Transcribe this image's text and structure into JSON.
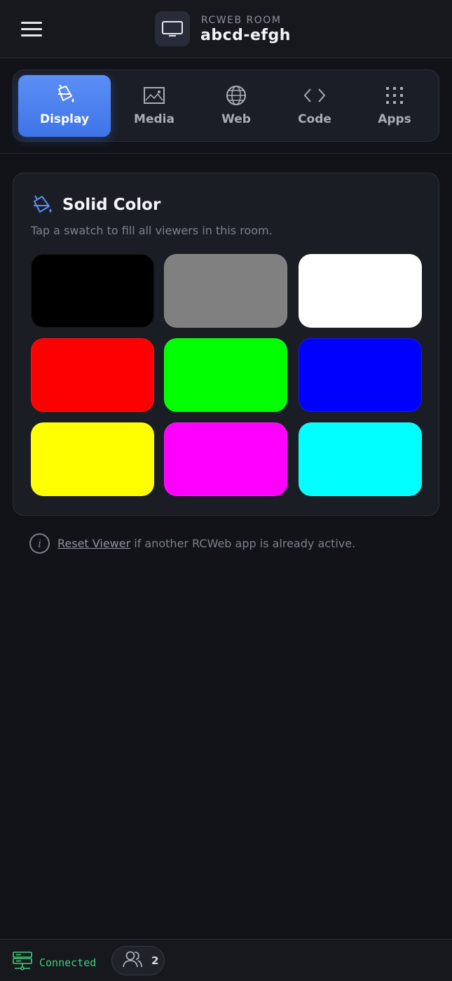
{
  "header": {
    "room_label": "RCWEB ROOM",
    "room_code": "abcd-efgh",
    "menu_icon": "hamburger-menu-icon",
    "room_icon": "monitor-icon"
  },
  "tabs": [
    {
      "label": "Display",
      "icon": "paint-bucket-icon",
      "active": true
    },
    {
      "label": "Media",
      "icon": "image-icon",
      "active": false
    },
    {
      "label": "Web",
      "icon": "globe-icon",
      "active": false
    },
    {
      "label": "Code",
      "icon": "code-brackets-icon",
      "active": false
    },
    {
      "label": "Apps",
      "icon": "grid-dots-icon",
      "active": false
    }
  ],
  "card": {
    "title": "Solid Color",
    "subtitle": "Tap a swatch to fill all viewers in this room.",
    "icon": "paint-bucket-icon",
    "swatches": [
      {
        "name": "black",
        "color": "#000000"
      },
      {
        "name": "gray",
        "color": "#808080"
      },
      {
        "name": "white",
        "color": "#ffffff"
      },
      {
        "name": "red",
        "color": "#ff0000"
      },
      {
        "name": "green",
        "color": "#00ff00"
      },
      {
        "name": "blue",
        "color": "#0000ff"
      },
      {
        "name": "yellow",
        "color": "#ffff00"
      },
      {
        "name": "magenta",
        "color": "#ff00ff"
      },
      {
        "name": "cyan",
        "color": "#00ffff"
      }
    ]
  },
  "info": {
    "link": "Reset Viewer",
    "text": " if another RCWeb app is already active."
  },
  "footer": {
    "status": "Connected",
    "status_color": "#3fd17a",
    "users_count": "2"
  },
  "colors": {
    "accent": "#4a80ee",
    "background": "#111318"
  }
}
